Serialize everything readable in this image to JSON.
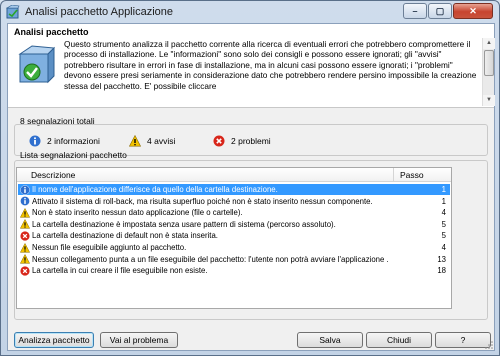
{
  "window": {
    "title": "Analisi pacchetto Applicazione",
    "minimize_label": "–",
    "maximize_label": "▢",
    "close_label": "✕"
  },
  "header": {
    "title": "Analisi pacchetto",
    "description": "Questo strumento analizza il pacchetto corrente alla ricerca di eventuali errori che potrebbero compromettere il processo di installazione. Le \"informazioni\" sono solo dei consigli e possono essere ignorati; gli \"avvisi\" potrebbero risultare in errori in fase di installazione, ma in alcuni casi possono essere ignorati; i \"problemi\" devono essere presi seriamente in considerazione dato che potrebbero rendere persino impossibile la creazione stessa del pacchetto. E' possibile cliccare"
  },
  "summary": {
    "group_label": "8 segnalazioni totali",
    "info_label": "2 informazioni",
    "warnings_label": "4 avvisi",
    "problems_label": "2 problemi"
  },
  "list": {
    "group_label": "Lista segnalazioni pacchetto",
    "col_description": "Descrizione",
    "col_step": "Passo",
    "rows": [
      {
        "type": "info",
        "text": "Il nome dell'applicazione differisce da quello della cartella destinazione.",
        "step": "1"
      },
      {
        "type": "info",
        "text": "Attivato il sistema di roll-back, ma risulta superfluo poiché non è stato inserito nessun componente.",
        "step": "1"
      },
      {
        "type": "warning",
        "text": "Non è stato inserito nessun dato applicazione (file o cartelle).",
        "step": "4"
      },
      {
        "type": "warning",
        "text": "La cartella destinazione è impostata senza usare pattern di sistema (percorso assoluto).",
        "step": "5"
      },
      {
        "type": "error",
        "text": "La cartella destinazione di default non è stata inserita.",
        "step": "5"
      },
      {
        "type": "warning",
        "text": "Nessun file eseguibile aggiunto al pacchetto.",
        "step": "4"
      },
      {
        "type": "warning",
        "text": "Nessun collegamento punta a un file eseguibile del pacchetto: l'utente non potrà avviare l'applicazione ...",
        "step": "13"
      },
      {
        "type": "error",
        "text": "La cartella in cui creare il file eseguibile non esiste.",
        "step": "18"
      }
    ]
  },
  "buttons": {
    "analyze": "Analizza pacchetto",
    "go_to_problem": "Vai al problema",
    "save": "Salva",
    "close": "Chiudi",
    "help": "?"
  },
  "colors": {
    "selection": "#3399ff",
    "info": "#2f6fce",
    "warning": "#f2c200",
    "error": "#d8261a"
  }
}
